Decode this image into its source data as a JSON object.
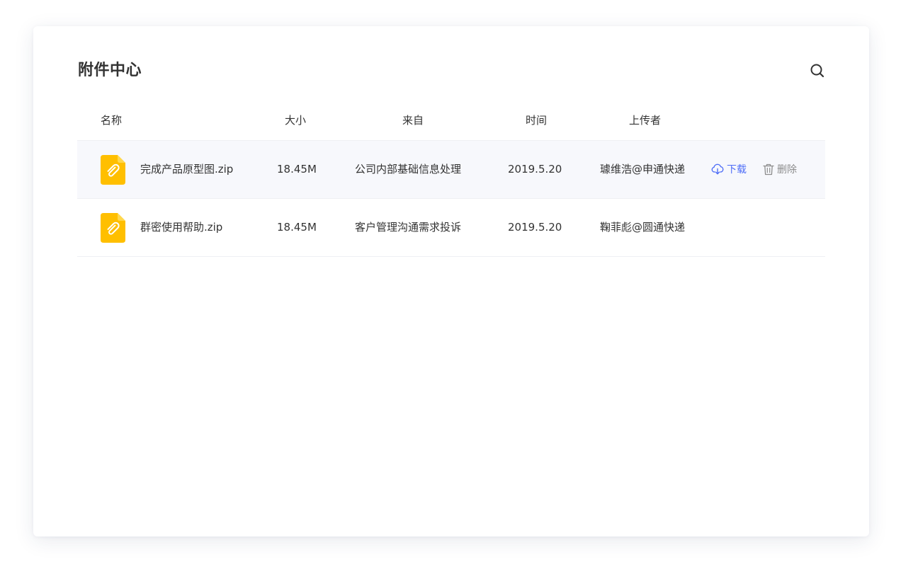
{
  "panel": {
    "title": "附件中心"
  },
  "columns": {
    "name": "名称",
    "size": "大小",
    "source": "来自",
    "time": "时间",
    "uploader": "上传者"
  },
  "files": [
    {
      "name": "完成产品原型图.zip",
      "size": "18.45M",
      "source": "公司内部基础信息处理",
      "time": "2019.5.20",
      "uploader": "璩维浩@申通快递",
      "download_label": "下载",
      "delete_label": "删除"
    },
    {
      "name": "群密使用帮助.zip",
      "size": "18.45M",
      "source": "客户管理沟通需求投诉",
      "time": "2019.5.20",
      "uploader": "鞠菲彪@圆通快递"
    }
  ],
  "icons": {
    "search": "search-icon",
    "file": "paperclip-file-icon",
    "download": "cloud-download-icon",
    "delete": "trash-icon"
  },
  "colors": {
    "file_icon": "#ffbf00",
    "file_icon_fold": "#ffd84d",
    "link_blue": "#4f6ef7",
    "hover_row": "#f7f8fc"
  }
}
